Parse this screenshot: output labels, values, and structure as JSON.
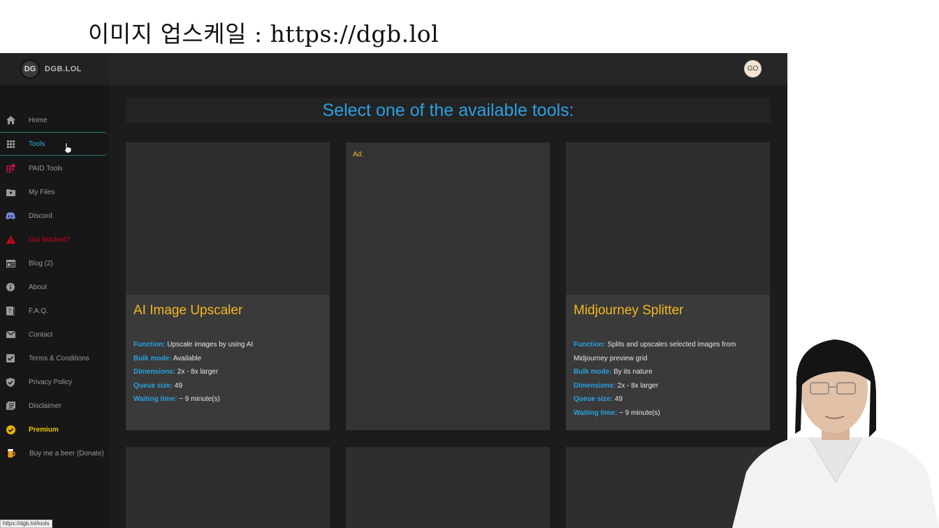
{
  "caption": "이미지 업스케일 : https://dgb.lol",
  "header": {
    "brand": "DGB.LOL",
    "logo_text": "DG",
    "avatar": "GO"
  },
  "sidebar": {
    "items": [
      {
        "label": "Home",
        "icon": "home-icon"
      },
      {
        "label": "Tools",
        "icon": "grid-icon"
      },
      {
        "label": "PAID Tools",
        "icon": "paid-tools-icon"
      },
      {
        "label": "My Files",
        "icon": "folder-icon"
      },
      {
        "label": "Discord",
        "icon": "discord-icon"
      },
      {
        "label": "Got blocked?",
        "icon": "warning-icon"
      },
      {
        "label": "Blog (2)",
        "icon": "blog-icon"
      },
      {
        "label": "About",
        "icon": "info-icon"
      },
      {
        "label": "F.A.Q.",
        "icon": "faq-icon"
      },
      {
        "label": "Contact",
        "icon": "mail-icon"
      },
      {
        "label": "Terms & Conditions",
        "icon": "check-square-icon"
      },
      {
        "label": "Privacy Policy",
        "icon": "shield-icon"
      },
      {
        "label": "Disclaimer",
        "icon": "document-icon"
      },
      {
        "label": "Premium",
        "icon": "badge-check-icon"
      },
      {
        "label": "Buy me a beer (Donate)",
        "icon": "beer-icon"
      }
    ],
    "active_index": 1
  },
  "main": {
    "heading": "Select one of the available tools:",
    "cards": [
      {
        "title": "AI Image Upscaler",
        "rows": [
          {
            "label": "Function:",
            "value": "Upscale images by using AI"
          },
          {
            "label": "Bulk mode:",
            "value": "Available"
          },
          {
            "label": "Dimensions:",
            "value": "2x - 8x larger"
          },
          {
            "label": "Queue size:",
            "value": "49"
          },
          {
            "label": "Waiting time:",
            "value": "~ 9 minute(s)"
          }
        ]
      },
      {
        "ad_label": "Ad:"
      },
      {
        "title": "Midjourney Splitter",
        "rows": [
          {
            "label": "Function:",
            "value": "Splits and upscales selected images from Midjourney preview grid"
          },
          {
            "label": "Bulk mode:",
            "value": "By its nature"
          },
          {
            "label": "Dimensions:",
            "value": "2x - 8x larger"
          },
          {
            "label": "Queue size:",
            "value": "49"
          },
          {
            "label": "Waiting time:",
            "value": "~ 9 minute(s)"
          }
        ]
      }
    ]
  },
  "status_url": "https://dgb.lol/tools",
  "colors": {
    "accent": "#2aa0e0",
    "title": "#f5b820",
    "danger": "#d0021b",
    "premium": "#e8c400"
  }
}
